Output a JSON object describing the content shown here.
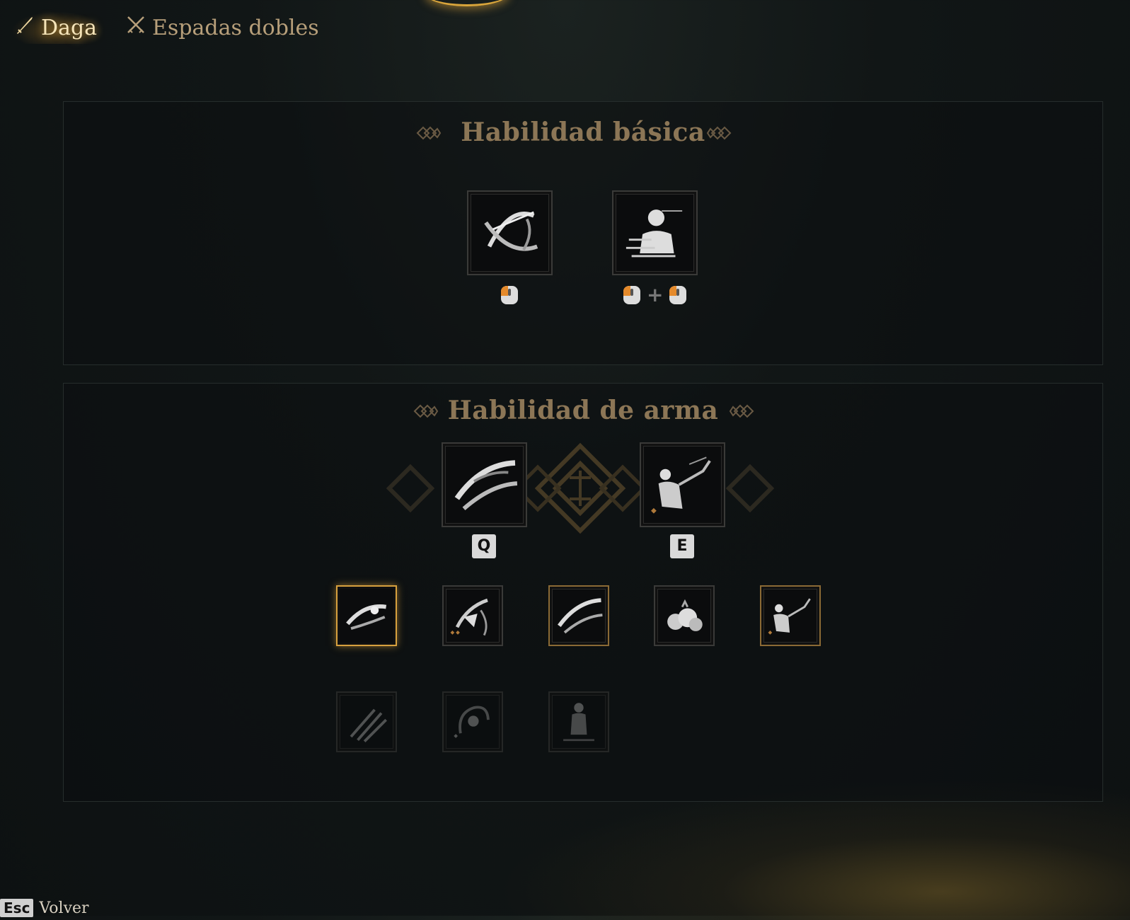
{
  "tabs": [
    {
      "label": "Daga",
      "icon": "dagger-icon",
      "active": true
    },
    {
      "label": "Espadas dobles",
      "icon": "crossed-swords-icon",
      "active": false
    }
  ],
  "basic_section": {
    "title": "Habilidad básica",
    "skills": [
      {
        "icon": "slash-circle-icon",
        "binding": "left-mouse"
      },
      {
        "icon": "silhouette-dash-icon",
        "binding": "left-mouse + left-mouse"
      }
    ],
    "plus_symbol": "+"
  },
  "weapon_section": {
    "title": "Habilidad de arma",
    "equipped": [
      {
        "icon": "blade-swoosh-icon",
        "key": "Q"
      },
      {
        "icon": "leaping-figure-icon",
        "key": "E"
      }
    ],
    "row1": [
      {
        "icon": "spinning-blade-icon",
        "state": "selected"
      },
      {
        "icon": "bird-slash-icon",
        "state": "normal"
      },
      {
        "icon": "blade-swoosh-icon",
        "state": "equipped"
      },
      {
        "icon": "smoke-cloud-icon",
        "state": "normal"
      },
      {
        "icon": "leaping-figure-icon",
        "state": "equipped"
      }
    ],
    "row2": [
      {
        "icon": "thrown-daggers-icon",
        "state": "locked"
      },
      {
        "icon": "whirlwind-figure-icon",
        "state": "locked"
      },
      {
        "icon": "shadow-figure-icon",
        "state": "locked"
      }
    ]
  },
  "footer": {
    "key": "Esc",
    "label": "Volver"
  },
  "colors": {
    "accent_gold": "#d8a13e",
    "title_text": "#8c7656",
    "mouse_orange": "#e58a2b"
  }
}
